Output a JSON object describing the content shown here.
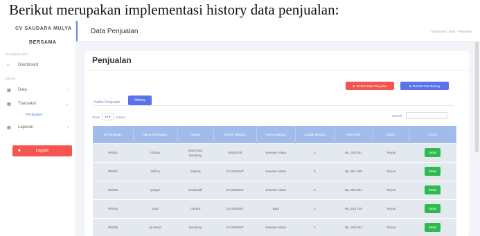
{
  "caption": "Berikut merupakan implementasi history data penjualan:",
  "sidebar": {
    "brand": "CV SAUDARA MULYA",
    "brand_sub": "BERSAMA",
    "section_dashboard": "DASHBOARD",
    "section_menu": "MENU",
    "items": [
      {
        "label": "Dashboard",
        "icon": "home-icon"
      },
      {
        "label": "Data",
        "icon": "grid-icon"
      },
      {
        "label": "Transaksi",
        "icon": "grid-icon"
      },
      {
        "label": "Laporan",
        "icon": "grid-icon"
      }
    ],
    "sub_item": "Penjualan",
    "logout": "Logout"
  },
  "topbar": {
    "title": "Data Penjualan",
    "breadcrumb": "Dashboard / Data / Penjualan"
  },
  "main": {
    "heading": "Penjualan",
    "btn_add_sale": "Tambah Data Penjualan",
    "btn_add_item": "Tambah Data Barang",
    "tab_list": "Daftar Penjualan",
    "tab_history": "History",
    "show_label": "Show",
    "show_value": "10",
    "entries_label": "entries",
    "search_label": "Search:"
  },
  "table": {
    "headers": [
      "ID Penjualan",
      "Nama Pelanggan",
      "Alamat",
      "Nomor Telepon",
      "Nama Barang",
      "Jumlah Barang",
      "Total Akhir",
      "Status",
      "Action"
    ],
    "rows": [
      [
        "PN001",
        "Ghiara",
        "buah batu bandung",
        "81823878",
        "Sweater Hitam",
        "3",
        "Rp. 300.001",
        "Terjual",
        "Detail"
      ],
      [
        "PN002",
        "Jeffrey",
        "sukang",
        "2147483647",
        "Sweater Hitam",
        "5",
        "Rp. 501.335",
        "Terjual",
        "Detail"
      ],
      [
        "PN003",
        "Ipolgar",
        "antabudhi",
        "2147483647",
        "Sweater Hitam",
        "3",
        "Rp. 300.801",
        "Terjual",
        "Detail"
      ],
      [
        "PN004",
        "Juan",
        "Cikutra",
        "2147483647",
        "Baju",
        "3",
        "Rp. 223.749",
        "Terjual",
        "Detail"
      ],
      [
        "PN005",
        "pa irman",
        "bandung",
        "2147483647",
        "Sweater Hitam",
        "2",
        "Rp. 200.534",
        "Terjual",
        "Detail"
      ]
    ]
  },
  "colors": {
    "accent": "#5b73e8",
    "danger": "#f4554f",
    "success": "#2fba4f",
    "table_header": "#9fbcea"
  }
}
